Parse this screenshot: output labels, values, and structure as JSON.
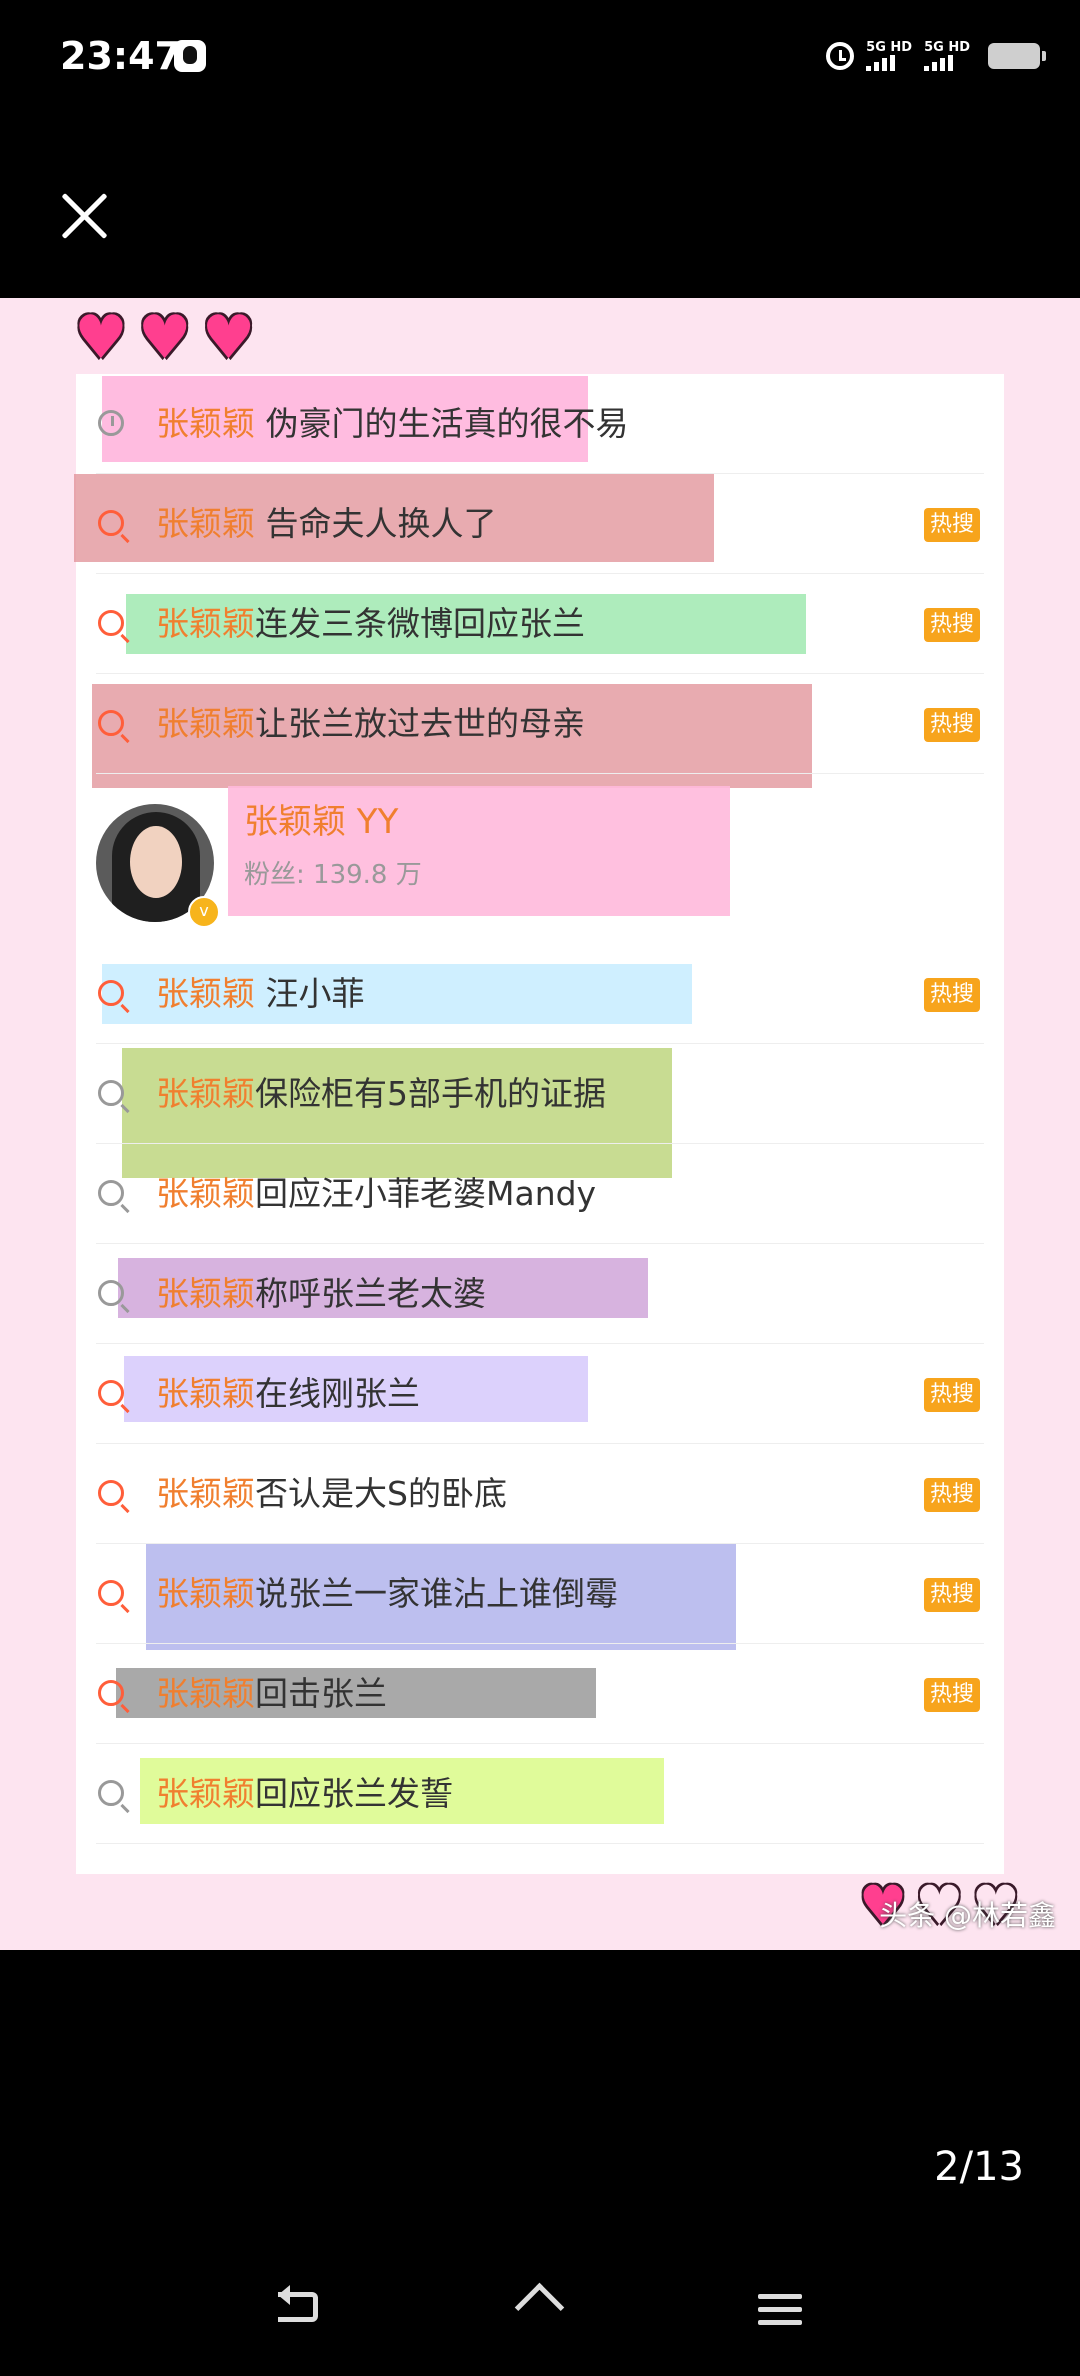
{
  "status_bar": {
    "time": "23:47",
    "network_1": "5G HD",
    "network_2": "5G HD"
  },
  "viewer": {
    "page_counter": "2/13"
  },
  "image": {
    "history_item": {
      "keyword": "张颖颖",
      "text": " 伪豪门的生活真的很不易",
      "highlight": "#ffa6d6"
    },
    "rows": [
      {
        "keyword": "张颖颖",
        "text": " 告命夫人换人了",
        "badge": "热搜",
        "icon": "hot-search-icon",
        "highlight": "#e08f95"
      },
      {
        "keyword": "张颖颖",
        "text": "连发三条微博回应张兰",
        "badge": "热搜",
        "icon": "hot-search-icon",
        "highlight": "#93e6a6"
      },
      {
        "keyword": "张颖颖",
        "text": "让张兰放过去世的母亲",
        "badge": "热搜",
        "icon": "hot-search-icon",
        "highlight": "#e08f95"
      }
    ],
    "user": {
      "name": "张颖颖 YY",
      "fans": "粉丝: 139.8 万"
    },
    "rows2": [
      {
        "keyword": "张颖颖",
        "text": " 汪小菲",
        "badge": "热搜",
        "icon": "hot-search-icon",
        "highlight": "#bfe9ff"
      },
      {
        "keyword": "张颖颖",
        "text": "保险柜有5部手机的证据",
        "badge": "",
        "icon": "search-icon",
        "highlight": "#b5d06e"
      },
      {
        "keyword": "张颖颖",
        "text": "回应汪小菲老婆Mandy",
        "badge": "",
        "icon": "search-icon",
        "highlight": ""
      },
      {
        "keyword": "张颖颖",
        "text": "称呼张兰老太婆",
        "badge": "",
        "icon": "search-icon",
        "highlight": "#c99ad4"
      },
      {
        "keyword": "张颖颖",
        "text": "在线刚张兰",
        "badge": "热搜",
        "icon": "hot-search-icon",
        "highlight": "#d0c2fb"
      },
      {
        "keyword": "张颖颖",
        "text": "否认是大S的卧底",
        "badge": "热搜",
        "icon": "hot-search-icon",
        "highlight": ""
      },
      {
        "keyword": "张颖颖",
        "text": "说张兰一家谁沾上谁倒霉",
        "badge": "热搜",
        "icon": "hot-search-icon",
        "highlight": "#a7a9e9"
      },
      {
        "keyword": "张颖颖",
        "text": "回击张兰",
        "badge": "热搜",
        "icon": "hot-search-icon",
        "highlight": "#8c8c8c"
      },
      {
        "keyword": "张颖颖",
        "text": "回应张兰发誓",
        "badge": "",
        "icon": "search-icon",
        "highlight": "#d6f978"
      }
    ],
    "watermark": "头条 @林若鑫"
  }
}
